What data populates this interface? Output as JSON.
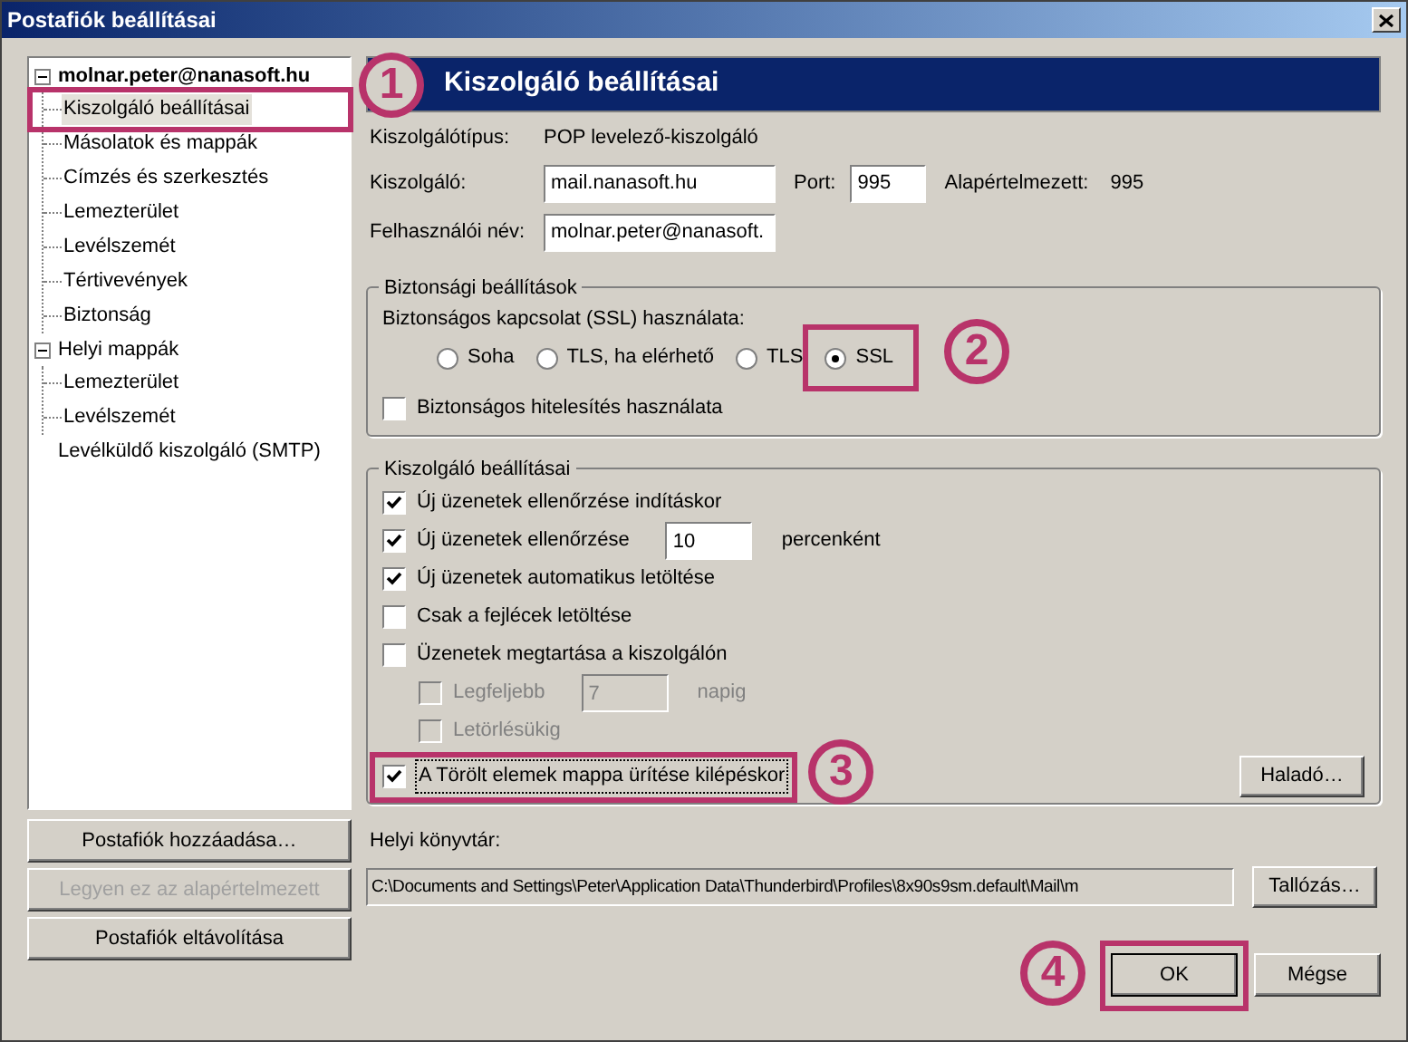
{
  "window": {
    "title": "Postafiók beállításai"
  },
  "tree": [
    {
      "label": "molnar.peter@nanasoft.hu",
      "bold": true,
      "expanded": true,
      "children": [
        {
          "label": "Kiszolgáló beállításai",
          "selected": true
        },
        {
          "label": "Másolatok és mappák",
          "selected": false
        },
        {
          "label": "Címzés és szerkesztés",
          "selected": false
        },
        {
          "label": "Lemezterület",
          "selected": false
        },
        {
          "label": "Levélszemét",
          "selected": false
        },
        {
          "label": "Tértivevények",
          "selected": false
        },
        {
          "label": "Biztonság",
          "selected": false
        }
      ]
    },
    {
      "label": "Helyi mappák",
      "bold": false,
      "expanded": true,
      "children": [
        {
          "label": "Lemezterület",
          "selected": false
        },
        {
          "label": "Levélszemét",
          "selected": false
        }
      ]
    },
    {
      "label": "Levélküldő kiszolgáló (SMTP)",
      "bold": false,
      "selected": false
    }
  ],
  "left_buttons": [
    {
      "label": "Postafiók hozzáadása…",
      "disabled": false
    },
    {
      "label": "Legyen ez az alapértelmezett",
      "disabled": true
    },
    {
      "label": "Postafiók eltávolítása",
      "disabled": false
    }
  ],
  "header": "Kiszolgáló beállításai",
  "server_type": {
    "label": "Kiszolgálótípus:",
    "value": "POP levelező-kiszolgáló"
  },
  "server": {
    "label": "Kiszolgáló:",
    "value": "mail.nanasoft.hu",
    "port_label": "Port:",
    "port": "995",
    "default_label": "Alapértelmezett:",
    "default": "995"
  },
  "username": {
    "label": "Felhasználói név:",
    "value": "molnar.peter@nanasoft."
  },
  "security": {
    "title": "Biztonsági beállítások",
    "ssl_label": "Biztonságos kapcsolat (SSL) használata:",
    "options": [
      {
        "label": "Soha",
        "selected": false
      },
      {
        "label": "TLS, ha elérhető",
        "selected": false
      },
      {
        "label": "TLS",
        "selected": false
      },
      {
        "label": "SSL",
        "selected": true
      }
    ],
    "secure_auth": {
      "label": "Biztonságos hitelesítés használata",
      "checked": false
    }
  },
  "server_settings": {
    "title": "Kiszolgáló beállításai",
    "options": [
      {
        "label": "Új üzenetek ellenőrzése indításkor",
        "checked": true,
        "disabled": false
      },
      {
        "label": "Új üzenetek ellenőrzése",
        "checked": true,
        "disabled": false,
        "value": "10",
        "suffix": "percenként"
      },
      {
        "label": "Új üzenetek automatikus letöltése",
        "checked": true,
        "disabled": false
      },
      {
        "label": "Csak a fejlécek letöltése",
        "checked": false,
        "disabled": false
      },
      {
        "label": "Üzenetek megtartása a kiszolgálón",
        "checked": false,
        "disabled": false,
        "children": [
          {
            "label": "Legfeljebb",
            "checked": false,
            "disabled": true,
            "value": "7",
            "suffix": "napig"
          },
          {
            "label": "Letörlésükig",
            "checked": false,
            "disabled": true
          }
        ]
      },
      {
        "label": "A Törölt elemek mappa ürítése kilépéskor",
        "checked": true,
        "disabled": false,
        "focused": true
      }
    ],
    "advanced_button": "Haladó…"
  },
  "local_dir": {
    "label": "Helyi könyvtár:",
    "value": "C:\\Documents and Settings\\Peter\\Application Data\\Thunderbird\\Profiles\\8x90s9sm.default\\Mail\\m",
    "browse": "Tallózás…"
  },
  "footer_buttons": [
    {
      "label": "OK",
      "default": true
    },
    {
      "label": "Mégse",
      "default": false
    }
  ],
  "callouts": [
    {
      "number": "1"
    },
    {
      "number": "2"
    },
    {
      "number": "3"
    },
    {
      "number": "4"
    }
  ]
}
